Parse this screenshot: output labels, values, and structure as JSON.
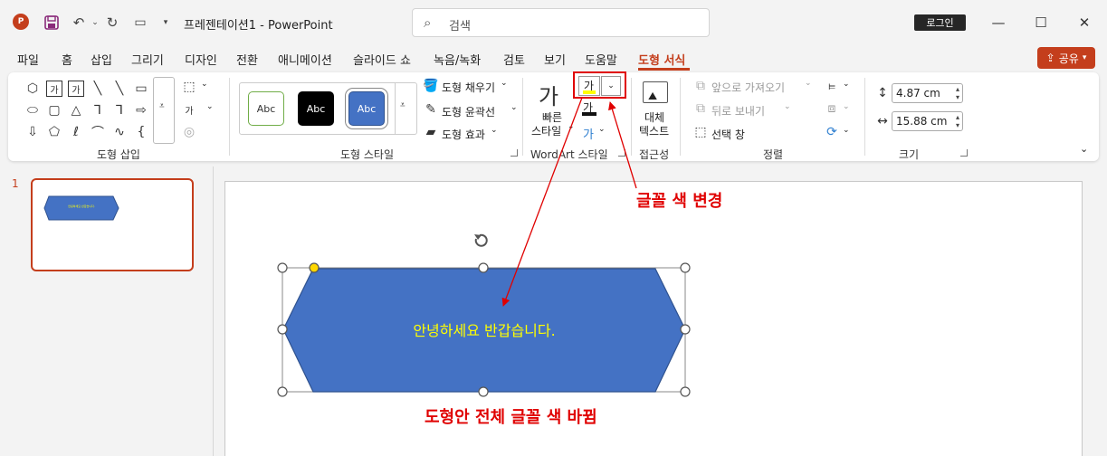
{
  "titlebar": {
    "doc_title": "프레젠테이션1  -  PowerPoint",
    "search_placeholder": "검색",
    "login_label": "로그인",
    "app_logo": "P"
  },
  "tabs": [
    "파일",
    "홈",
    "삽입",
    "그리기",
    "디자인",
    "전환",
    "애니메이션",
    "슬라이드 쇼",
    "녹음/녹화",
    "검토",
    "보기",
    "도움말",
    "도형 서식"
  ],
  "active_tab": "도형 서식",
  "share_label": "공유",
  "ribbon": {
    "insert_shapes_label": "도형 삽입",
    "shape_styles_label": "도형 스타일",
    "wordart_label": "WordArt 스타일",
    "accessibility_label": "접근성",
    "arrange_label": "정렬",
    "size_label": "크기",
    "style_sample": "Abc",
    "fill_label": "도형 채우기",
    "outline_label": "도형 윤곽선",
    "effects_label": "도형 효과",
    "quick_styles_line1": "빠른",
    "quick_styles_line2": "스타일",
    "text_fill_glyph": "가",
    "alt_text_line1": "대체",
    "alt_text_line2": "텍스트",
    "bring_forward": "앞으로 가져오기",
    "send_backward": "뒤로 보내기",
    "selection_pane": "선택 창",
    "height_value": "4.87 cm",
    "width_value": "15.88 cm"
  },
  "slide_panel": {
    "slide_number": "1",
    "thumb_text": "안녕하세요 반갑습니다."
  },
  "slide": {
    "shape_text": "안녕하세요 반갑습니다.",
    "shape_fill": "#4472c4",
    "shape_text_color": "#ffff00"
  },
  "annotations": {
    "font_color_change": "글꼴 색 변경",
    "shape_text_changed": "도형안 전체 글꼴 색 바뀜"
  },
  "colors": {
    "accent": "#c43e1c",
    "annotation": "#e00000"
  }
}
